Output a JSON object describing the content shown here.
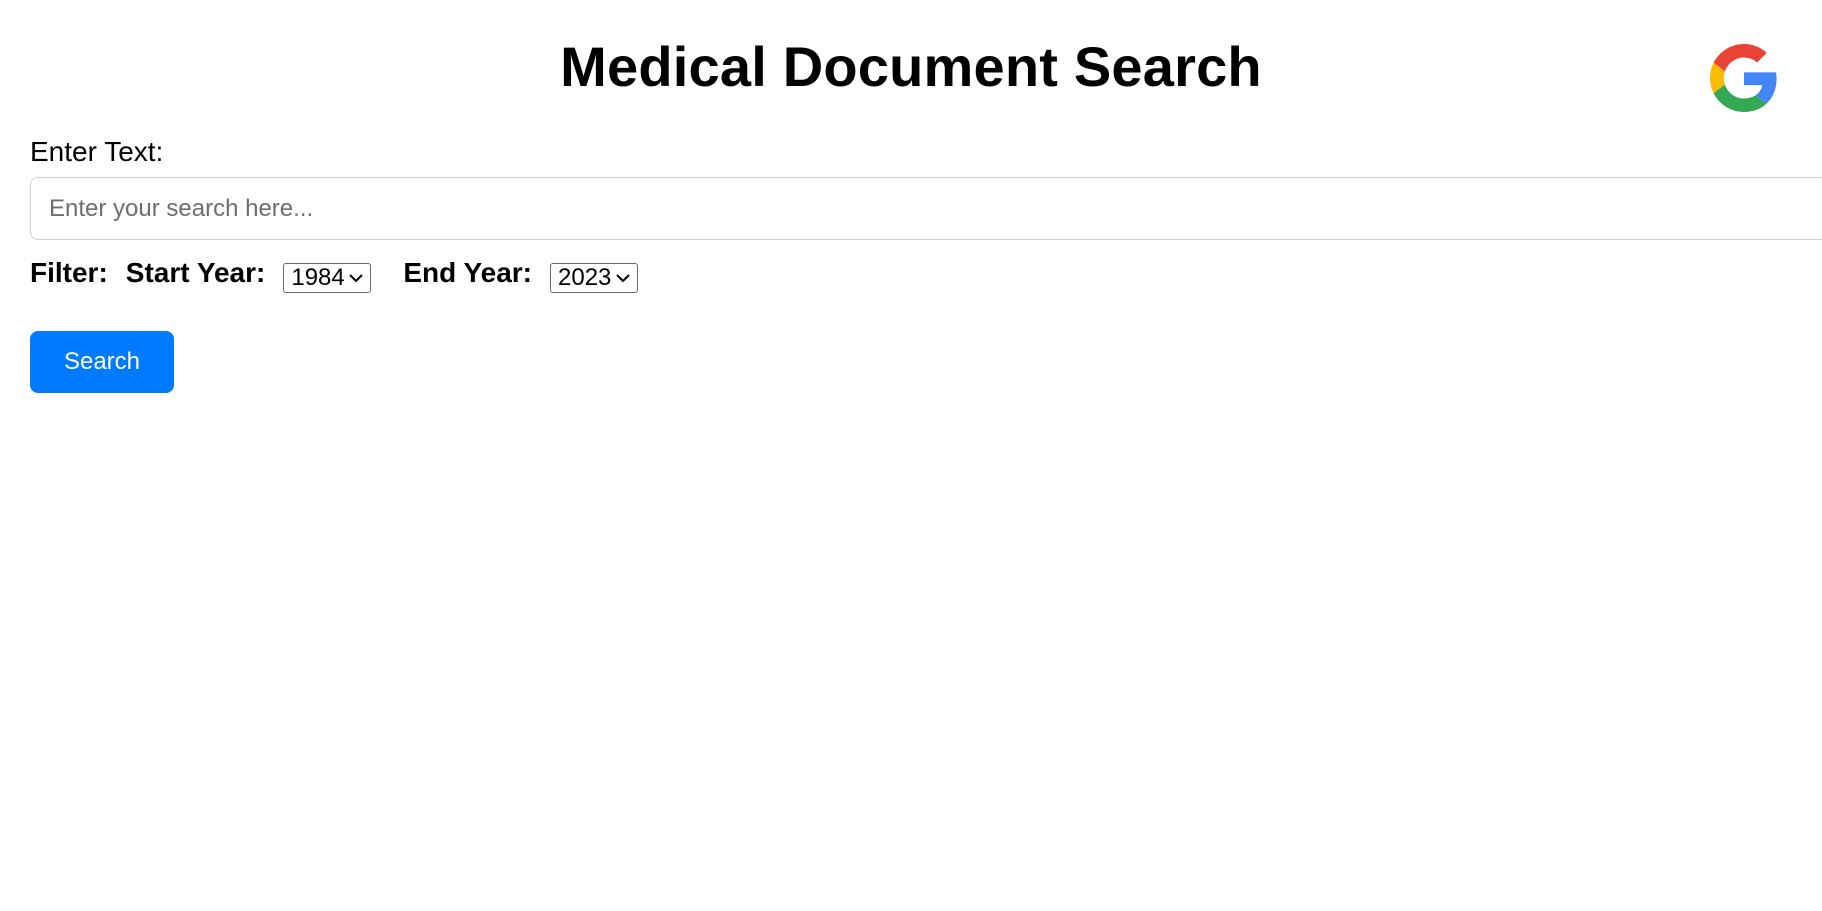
{
  "header": {
    "title": "Medical Document Search",
    "logo_icon": "google-g-icon",
    "logo_colors": {
      "red": "#EA4335",
      "yellow": "#FBBC05",
      "green": "#34A853",
      "blue": "#4285F4"
    }
  },
  "search": {
    "label": "Enter Text:",
    "value": "",
    "placeholder": "Enter your search here..."
  },
  "filter": {
    "label": "Filter:",
    "start_year": {
      "label": "Start Year:",
      "selected": "1984",
      "icon": "chevron-down-icon"
    },
    "end_year": {
      "label": "End Year:",
      "selected": "2023",
      "icon": "chevron-down-icon"
    }
  },
  "actions": {
    "search_label": "Search",
    "button_color": "#007bff"
  }
}
